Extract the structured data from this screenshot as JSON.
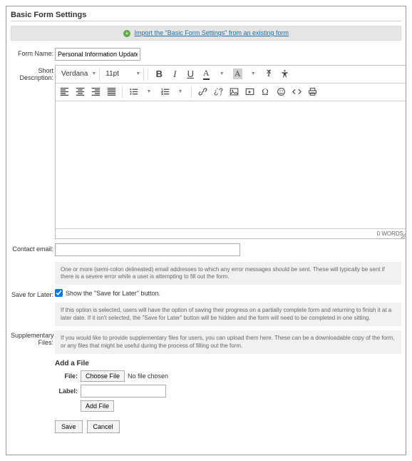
{
  "page_title": "Basic Form Settings",
  "import_link": "Import the \"Basic Form Settings\" from an existing form",
  "labels": {
    "form_name": "Form Name:",
    "short_description": "Short Description:",
    "contact_email": "Contact email:",
    "save_for_later": "Save for Later:",
    "supplementary_files": "Supplementary Files:"
  },
  "form_name_value": "Personal Information Update",
  "editor": {
    "font_family": "Verdana",
    "font_size": "11pt",
    "word_count": "0 WORDS"
  },
  "contact_email_value": "",
  "contact_email_help": "One or more (semi-colon delineated) email addresses to which any error messages should be sent. These will typically be sent if there is a severe error while a user is attempting to fill out the form.",
  "save_for_later_checkbox_label": "Show the \"Save for Later\" button.",
  "save_for_later_checked": true,
  "save_for_later_help": "If this option is selected, users will have the option of saving their progress on a partially complete form and returning to finish it at a later date. If it isn't selected, the \"Save for Later\" button will be hidden and the form will need to be completed in one sitting.",
  "supplementary_help": "If you would like to provide supplementary files for users, you can upload them here. These can be a downloadable copy of the form, or any files that might be useful during the process of filling out the form.",
  "add_file": {
    "heading": "Add a File",
    "file_label": "File:",
    "choose_button": "Choose File",
    "no_file_text": "No file chosen",
    "label_label": "Label:",
    "label_value": "",
    "add_button": "Add File"
  },
  "buttons": {
    "save": "Save",
    "cancel": "Cancel"
  }
}
